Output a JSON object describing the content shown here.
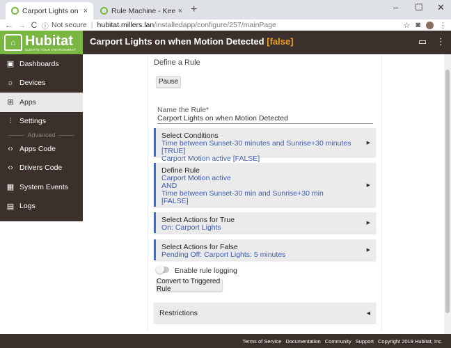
{
  "browser": {
    "tabs": [
      {
        "title": "Carport Lights on when Motion D",
        "close": "×"
      },
      {
        "title": "Rule Machine - Keep Lights ON",
        "close": "×"
      }
    ],
    "new_tab": "+",
    "window_controls": [
      "–",
      "☐",
      "✕"
    ],
    "nav": {
      "back": "←",
      "forward": "→",
      "reload": "C"
    },
    "address": {
      "security": "Not secure",
      "host": "hubitat.millers.lan",
      "path": "/installedapp/configure/257/mainPage"
    }
  },
  "app": {
    "brand": "Hubitat",
    "tagline": "ELEVATE YOUR ENVIRONMENT",
    "title": "Carport Lights on when Motion Detected",
    "title_flag": "[false]",
    "flag_color": "#f0a020",
    "accent_color": "#7ab642",
    "header_color": "#3b302b"
  },
  "sidebar": {
    "items": [
      {
        "label": "Dashboards",
        "icon": "dashboard-icon"
      },
      {
        "label": "Devices",
        "icon": "lightbulb-icon"
      },
      {
        "label": "Apps",
        "icon": "apps-grid-icon",
        "active": true
      },
      {
        "label": "Settings",
        "icon": "sliders-icon"
      }
    ],
    "advanced_label": "Advanced",
    "advanced_items": [
      {
        "label": "Apps Code",
        "icon": "code-icon"
      },
      {
        "label": "Drivers Code",
        "icon": "code-icon"
      },
      {
        "label": "System Events",
        "icon": "calendar-icon"
      },
      {
        "label": "Logs",
        "icon": "document-icon"
      }
    ]
  },
  "main": {
    "section_title": "Define a Rule",
    "pause_button": "Pause",
    "name_label": "Name the Rule*",
    "name_value": "Carport Lights on when Motion Detected",
    "cards": [
      {
        "title": "Select Conditions",
        "lines": [
          "Time between Sunset-30 minutes and Sunrise+30 minutes [TRUE]",
          "Carport Motion active [FALSE]"
        ]
      },
      {
        "title": "Define Rule",
        "lines": [
          "Carport Motion active",
          "AND",
          "Time between Sunset-30 min and Sunrise+30 min",
          "[FALSE]"
        ]
      },
      {
        "title": "Select Actions for True",
        "lines": [
          "On: Carport Lights"
        ]
      },
      {
        "title": "Select Actions for False",
        "lines": [
          "Pending Off: Carport Lights: 5 minutes"
        ]
      }
    ],
    "logging_label": "Enable rule logging",
    "convert_button": "Convert to Triggered Rule",
    "restrictions": "Restrictions"
  },
  "footer": {
    "links": [
      "Terms of Service",
      "Documentation",
      "Community",
      "Support",
      "Copyright 2019 Hubitat, Inc."
    ]
  }
}
